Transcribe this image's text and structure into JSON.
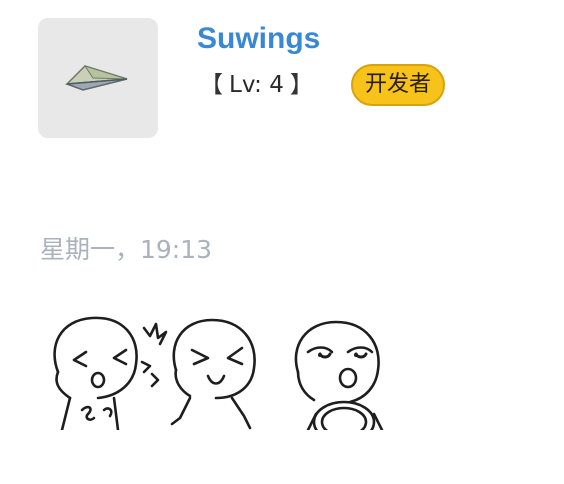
{
  "profile": {
    "username": "Suwings",
    "level_open": "【",
    "level_text": "Lv: 4",
    "level_close": "】",
    "badge": "开发者",
    "avatar_icon": "paper-plane-icon"
  },
  "chat": {
    "time_divider": "星期一，19:13",
    "message": {
      "type": "sticker",
      "sticker_icon": "three-meme-faces-sticker"
    }
  },
  "colors": {
    "username": "#3a87d4",
    "badge_bg": "#f7c21a",
    "time_text": "#a9b2bd",
    "avatar_bg": "#e8e8e8"
  }
}
